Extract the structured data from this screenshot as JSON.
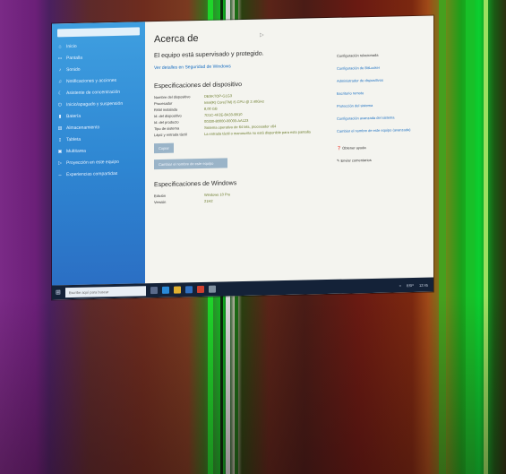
{
  "window": {
    "page_title": "Acerca de"
  },
  "sidebar": {
    "items": [
      {
        "icon": "home-icon",
        "label": "Inicio"
      },
      {
        "icon": "display-icon",
        "label": "Pantalla"
      },
      {
        "icon": "sound-icon",
        "label": "Sonido"
      },
      {
        "icon": "bell-icon",
        "label": "Notificaciones y acciones"
      },
      {
        "icon": "focus-icon",
        "label": "Asistente de concentración"
      },
      {
        "icon": "power-icon",
        "label": "Inicio/apagado y suspensión"
      },
      {
        "icon": "battery-icon",
        "label": "Batería"
      },
      {
        "icon": "storage-icon",
        "label": "Almacenamiento"
      },
      {
        "icon": "tablet-icon",
        "label": "Tableta"
      },
      {
        "icon": "multitask-icon",
        "label": "Multitarea"
      },
      {
        "icon": "project-icon",
        "label": "Proyección en este equipo"
      },
      {
        "icon": "shared-icon",
        "label": "Experiencias compartidas"
      }
    ]
  },
  "main": {
    "protect_heading": "El equipo está supervisado y protegido.",
    "security_link": "Ver detalles en Seguridad de Windows",
    "device_specs_title": "Especificaciones del dispositivo",
    "device_specs": [
      {
        "key": "Nombre del dispositivo",
        "value": "DESKTOP-G1G3"
      },
      {
        "key": "Procesador",
        "value": "Intel(R) Core(TM) i5 CPU @ 2.40GHz"
      },
      {
        "key": "RAM instalada",
        "value": "8,00 GB"
      },
      {
        "key": "Id. del dispositivo",
        "value": "7D1C-4F2E-8A33-9B10"
      },
      {
        "key": "Id. del producto",
        "value": "00330-80000-00000-AA123"
      },
      {
        "key": "Tipo de sistema",
        "value": "Sistema operativo de 64 bits, procesador x64"
      },
      {
        "key": "Lápiz y entrada táctil",
        "value": "La entrada táctil o manuscrita no está disponible para esta pantalla"
      }
    ],
    "copy_button": "Copiar",
    "rename_button": "Cambiar el nombre de este equipo",
    "windows_specs_title": "Especificaciones de Windows",
    "windows_specs": [
      {
        "key": "Edición",
        "value": "Windows 10 Pro"
      },
      {
        "key": "Versión",
        "value": "21H2"
      }
    ]
  },
  "related": {
    "links": [
      "Configuración relacionada",
      "Configuración de BitLocker",
      "Administrador de dispositivos",
      "Escritorio remoto",
      "Protección del sistema",
      "Configuración avanzada del sistema",
      "Cambiar el nombre de este equipo (avanzado)"
    ],
    "help_links": [
      "Obtener ayuda",
      "Enviar comentarios"
    ]
  },
  "taskbar": {
    "search_placeholder": "Escribe aquí para buscar",
    "tray_text": "ESP",
    "time": "12:45"
  }
}
